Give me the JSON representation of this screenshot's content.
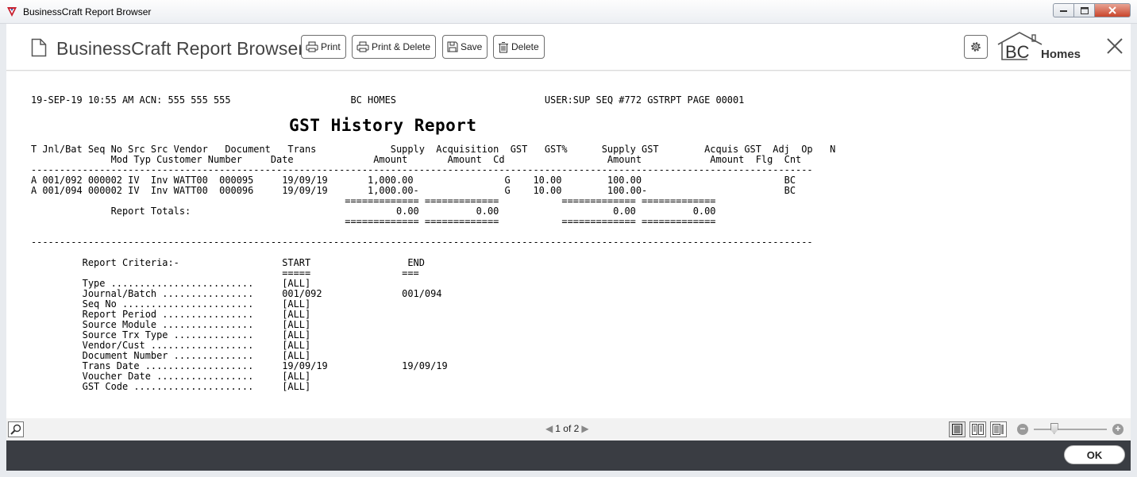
{
  "window": {
    "title": "BusinessCraft Report Browser"
  },
  "header": {
    "title": "BusinessCraft Report Browser",
    "buttons": {
      "print": "Print",
      "print_delete": "Print & Delete",
      "save": "Save",
      "delete": "Delete"
    },
    "logo": {
      "text_bc": "BC",
      "text_homes": "Homes"
    }
  },
  "report": {
    "header_line": "19-SEP-19 10:55 AM ACN: 555 555 555                     BC HOMES                          USER:SUP SEQ #772 GSTRPT PAGE 00001",
    "title": "GST History Report",
    "body_lines": [
      "T Jnl/Bat Seq No Src Src Vendor   Document   Trans             Supply  Acquisition  GST   GST%      Supply GST        Acquis GST  Adj  Op   N",
      "              Mod Typ Customer Number     Date              Amount       Amount  Cd                  Amount            Amount  Flg  Cnt",
      "-----------------------------------------------------------------------------------------------------------------------------------------",
      "A 001/092 000002 IV  Inv WATT00  000095     19/09/19       1,000.00                G    10.00        100.00                         BC",
      "A 001/094 000002 IV  Inv WATT00  000096     19/09/19       1,000.00-               G    10.00        100.00-                        BC",
      "                                                       ============= =============           ============= =============",
      "              Report Totals:                                    0.00          0.00                    0.00          0.00",
      "                                                       ============= =============           ============= =============",
      "",
      "-----------------------------------------------------------------------------------------------------------------------------------------"
    ],
    "criteria_lines": [
      "         Report Criteria:-                  START                 END",
      "                                            =====                ===",
      "         Type .........................     [ALL]",
      "         Journal/Batch ................     001/092              001/094",
      "         Seq No .......................     [ALL]",
      "         Report Period ................     [ALL]",
      "         Source Module ................     [ALL]",
      "         Source Trx Type ..............     [ALL]",
      "         Vendor/Cust ..................     [ALL]",
      "         Document Number ..............     [ALL]",
      "         Trans Date ...................     19/09/19             19/09/19",
      "         Voucher Date .................     [ALL]",
      "         GST Code .....................     [ALL]"
    ]
  },
  "nav": {
    "page": "1",
    "of_label": "of",
    "total_pages": "2",
    "zoom_percent": 28
  },
  "footer": {
    "ok_label": "OK"
  }
}
